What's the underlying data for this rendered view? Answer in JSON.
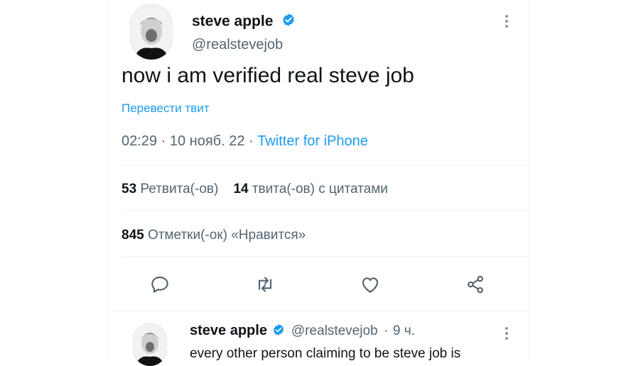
{
  "tweet": {
    "author_name": "steve apple",
    "author_handle": "@realstevejob",
    "text": "now i am verified real steve job",
    "translate_label": "Перевести твит",
    "time": "02:29",
    "date": "10 нояб. 22",
    "source": "Twitter for iPhone",
    "retweets_count": "53",
    "retweets_label": "Ретвита(-ов)",
    "quotes_count": "14",
    "quotes_label": "твита(-ов) с цитатами",
    "likes_count": "845",
    "likes_label": "Отметки(-ок) «Нравится»"
  },
  "reply": {
    "author_name": "steve apple",
    "author_handle": "@realstevejob",
    "time_ago": "9 ч.",
    "text": "every other person claiming to be steve job is"
  },
  "colors": {
    "accent": "#1d9bf0",
    "secondary_text": "#536471",
    "primary_text": "#0f1419",
    "divider": "#eff3f4"
  },
  "icons": [
    "verified-badge-icon",
    "more-icon",
    "reply-icon",
    "retweet-icon",
    "like-icon",
    "share-icon"
  ]
}
